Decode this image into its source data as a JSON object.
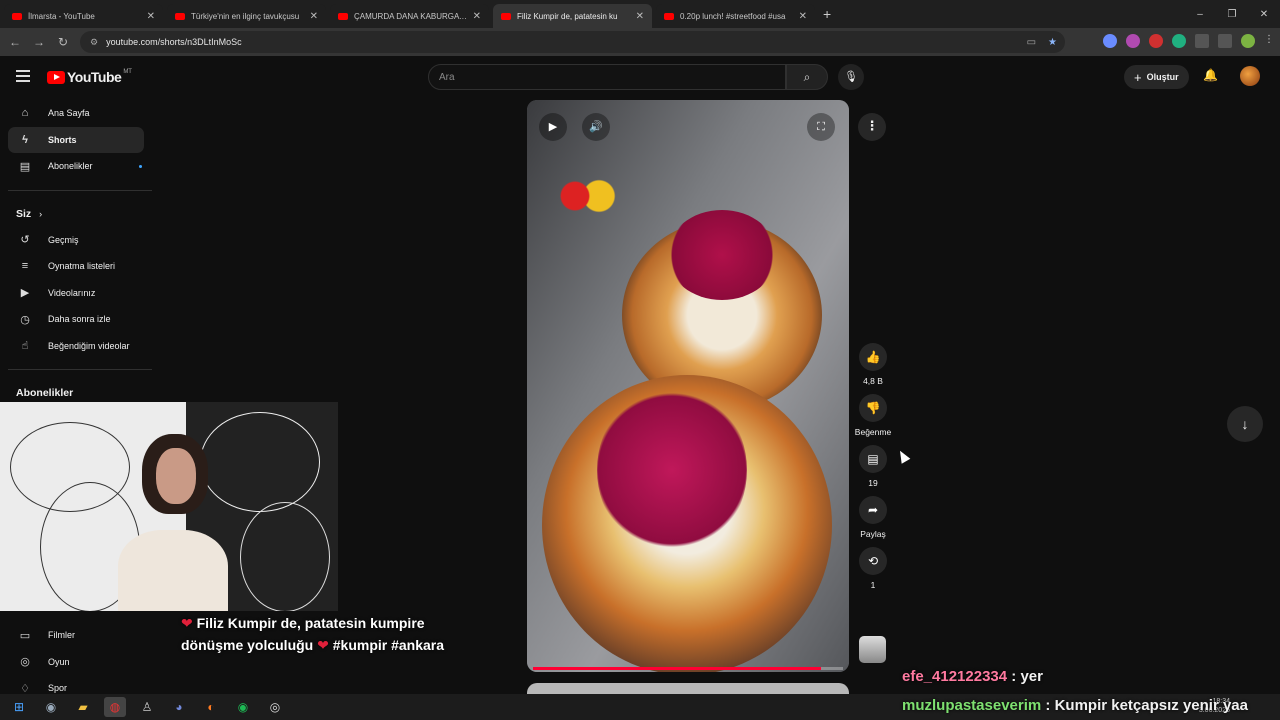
{
  "browser": {
    "tabs": [
      {
        "title": "İlmarsta - YouTube",
        "active": false
      },
      {
        "title": "Türkiye'nin en ilginç tavukçusu",
        "active": false
      },
      {
        "title": "ÇAMURDA DANA KABURGA PİŞ",
        "active": false
      },
      {
        "title": "Filiz Kumpir de, patatesin ku",
        "active": true
      },
      {
        "title": "0.20p lunch! #streetfood #usa",
        "active": false
      }
    ],
    "url": "youtube.com/shorts/n3DLtInMoSc",
    "window_controls": [
      "–",
      "❐",
      "✕"
    ]
  },
  "header": {
    "logo_text": "YouTube",
    "country_code": "MT",
    "search_placeholder": "Ara",
    "create_label": "Oluştur"
  },
  "sidebar": {
    "main_items": [
      {
        "label": "Ana Sayfa",
        "icon": "home-icon",
        "glyph": "⌂"
      },
      {
        "label": "Shorts",
        "icon": "shorts-icon",
        "glyph": "ϟ",
        "active": true
      },
      {
        "label": "Abonelikler",
        "icon": "subscriptions-icon",
        "glyph": "▤",
        "new_dot": true
      }
    ],
    "you_heading": "Siz",
    "you_items": [
      {
        "label": "Geçmiş",
        "icon": "history-icon",
        "glyph": "↺"
      },
      {
        "label": "Oynatma listeleri",
        "icon": "playlists-icon",
        "glyph": "≡"
      },
      {
        "label": "Videolarınız",
        "icon": "your-videos-icon",
        "glyph": "▶"
      },
      {
        "label": "Daha sonra izle",
        "icon": "watch-later-icon",
        "glyph": "◷"
      },
      {
        "label": "Beğendiğim videolar",
        "icon": "liked-icon",
        "glyph": "👍"
      }
    ],
    "subs_heading": "Abonelikler",
    "explore_items": [
      {
        "label": "Filmler",
        "icon": "movies-icon",
        "glyph": "▭"
      },
      {
        "label": "Oyun",
        "icon": "gaming-icon",
        "glyph": "◎"
      },
      {
        "label": "Spor",
        "icon": "sports-icon",
        "glyph": "♢"
      }
    ]
  },
  "short": {
    "caption_line1": "Filiz Kumpir de, patatesin kumpire",
    "caption_line2": "dönüşme yolculuğu",
    "caption_tags": "#kumpir #ankara",
    "progress": 0.93,
    "actions": {
      "like_count": "4,8 B",
      "dislike_label": "Beğenme",
      "comment_count": "19",
      "share_label": "Paylaş",
      "remix_count": "1"
    }
  },
  "chat": [
    {
      "user": "efe_412122334",
      "message": ": yer"
    },
    {
      "user": "muzlupastaseverim",
      "message": ": Kumpir ketçapsız yenir yaa"
    }
  ],
  "taskbar": {
    "time": "18:34",
    "date": "3.06.2025"
  },
  "colors": {
    "brand_red": "#ff0000",
    "background": "#0f0f0f",
    "accent_blue": "#3ea6ff"
  }
}
